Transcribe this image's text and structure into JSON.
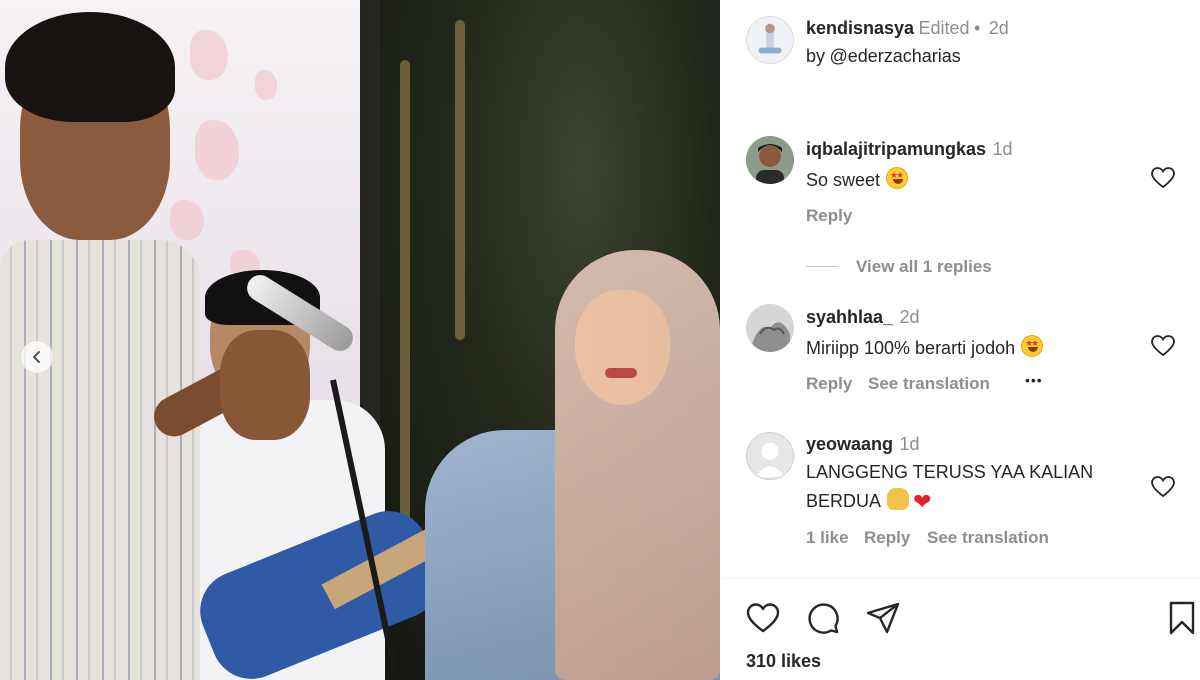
{
  "post": {
    "author": "kendisnasya",
    "edited": "Edited",
    "dot": "•",
    "time": "2d",
    "by_prefix": "by",
    "by_handle": "@ederzacharias"
  },
  "comments": [
    {
      "username": "iqbalajitripamungkas",
      "time": "1d",
      "text": "So sweet",
      "emoji": "star-struck",
      "reply_label": "Reply",
      "view_replies_label": "View all 1 replies"
    },
    {
      "username": "syahhlaa_",
      "time": "2d",
      "text": "Miriipp 100% berarti jodoh",
      "emoji": "star-struck",
      "reply_label": "Reply",
      "translate_label": "See translation",
      "more_label": "•••"
    },
    {
      "username": "yeowaang",
      "time": "1d",
      "text_line1": "LANGGENG TERUSS YAA KALIAN",
      "text_line2": "BERDUA",
      "emoji": "raising-hands",
      "heart_emoji": "❤",
      "likes_label": "1 like",
      "reply_label": "Reply",
      "translate_label": "See translation"
    }
  ],
  "actions": {
    "like_icon": "heart-icon",
    "comment_icon": "comment-icon",
    "share_icon": "send-icon",
    "save_icon": "bookmark-icon"
  },
  "likes_count": "310 likes",
  "colors": {
    "text": "#262626",
    "muted": "#8e8e8e",
    "link": "#00376b",
    "heart_red": "#e0242f"
  }
}
